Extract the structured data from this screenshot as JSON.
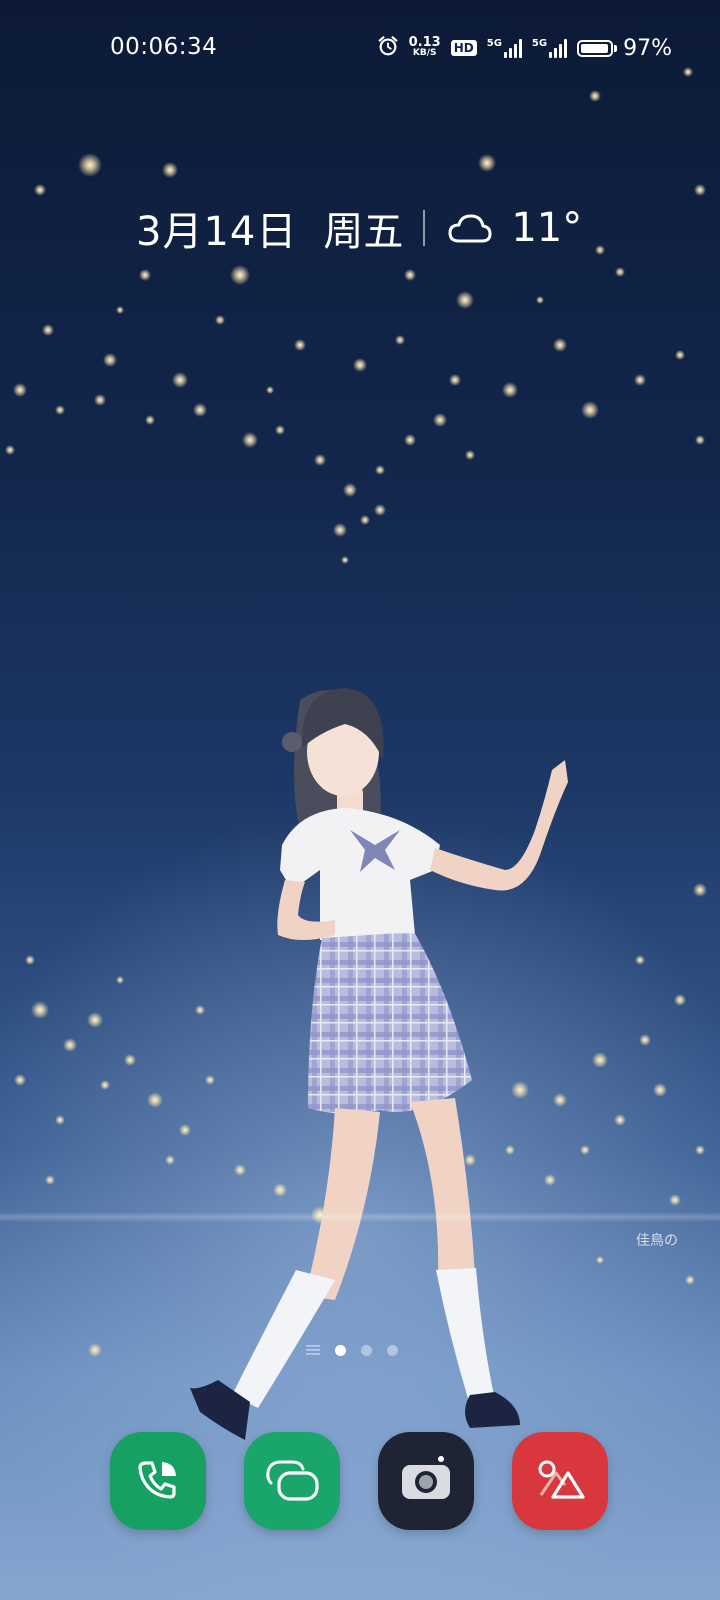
{
  "status_bar": {
    "time": "00:06:34",
    "alarm_icon": "alarm-clock-icon",
    "net_speed": {
      "value": "0.13",
      "unit": "KB/S"
    },
    "hd_badge": "HD",
    "sim1": {
      "label": "5G",
      "bars_filled": 4
    },
    "sim2": {
      "label": "5G",
      "bars_filled": 4
    },
    "battery": {
      "percent_text": "97%",
      "level": 0.97
    }
  },
  "date_widget": {
    "date": "3月14日",
    "weekday": "周五",
    "weather_icon": "cloud-icon",
    "temperature": "11°"
  },
  "wallpaper": {
    "signature": "佳鳥の"
  },
  "page_indicator": {
    "pages": 3,
    "active_index": 0,
    "list_icon": "list-icon"
  },
  "dock": {
    "apps": [
      {
        "name": "phone",
        "icon": "phone-icon",
        "color": "#16a061"
      },
      {
        "name": "messages",
        "icon": "message-bubble-icon",
        "color": "#1aa56b"
      },
      {
        "name": "camera",
        "icon": "camera-icon",
        "color": "#1e2433"
      },
      {
        "name": "gallery",
        "icon": "gallery-shapes-icon",
        "color": "#d8383d"
      }
    ]
  },
  "colors": {
    "sky_top": "#0c1a36",
    "sky_bottom": "#86a6cf"
  }
}
